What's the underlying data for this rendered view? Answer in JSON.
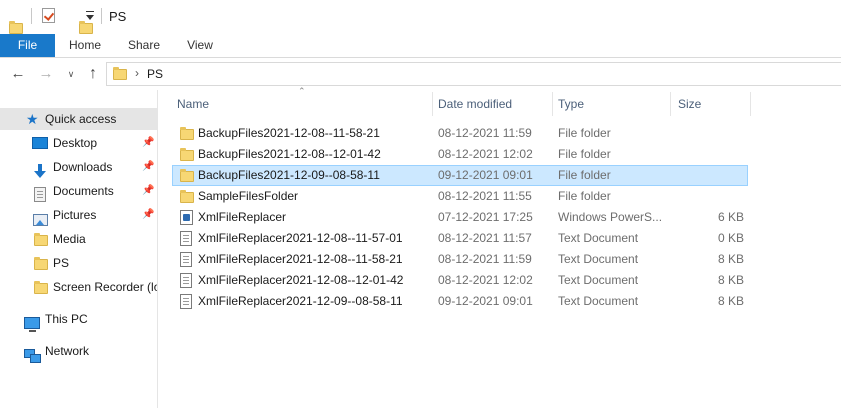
{
  "window": {
    "title": "PS"
  },
  "ribbon": {
    "tabs": [
      {
        "label": "File"
      },
      {
        "label": "Home"
      },
      {
        "label": "Share"
      },
      {
        "label": "View"
      }
    ]
  },
  "address": {
    "crumb": "PS"
  },
  "nav_pane": {
    "quick_access": {
      "label": "Quick access",
      "icon": "star-icon"
    },
    "items": [
      {
        "label": "Desktop",
        "icon": "desktop-icon",
        "pinned": true
      },
      {
        "label": "Downloads",
        "icon": "download-icon",
        "pinned": true
      },
      {
        "label": "Documents",
        "icon": "documents-icon",
        "pinned": true
      },
      {
        "label": "Pictures",
        "icon": "pictures-icon",
        "pinned": true
      },
      {
        "label": "Media",
        "icon": "folder-icon",
        "pinned": false
      },
      {
        "label": "PS",
        "icon": "folder-icon",
        "pinned": false
      },
      {
        "label": "Screen Recorder (lo",
        "icon": "folder-icon",
        "pinned": false
      }
    ],
    "this_pc": {
      "label": "This PC",
      "icon": "computer-icon"
    },
    "network": {
      "label": "Network",
      "icon": "network-icon"
    }
  },
  "columns": {
    "name": "Name",
    "date": "Date modified",
    "type": "Type",
    "size": "Size"
  },
  "files": [
    {
      "name": "BackupFiles2021-12-08--11-58-21",
      "date": "08-12-2021 11:59",
      "type": "File folder",
      "size": "",
      "icon": "folder-icon",
      "selected": false
    },
    {
      "name": "BackupFiles2021-12-08--12-01-42",
      "date": "08-12-2021 12:02",
      "type": "File folder",
      "size": "",
      "icon": "folder-icon",
      "selected": false
    },
    {
      "name": "BackupFiles2021-12-09--08-58-11",
      "date": "09-12-2021 09:01",
      "type": "File folder",
      "size": "",
      "icon": "folder-icon",
      "selected": true
    },
    {
      "name": "SampleFilesFolder",
      "date": "08-12-2021 11:55",
      "type": "File folder",
      "size": "",
      "icon": "folder-icon",
      "selected": false
    },
    {
      "name": "XmlFileReplacer",
      "date": "07-12-2021 17:25",
      "type": "Windows PowerS...",
      "size": "6 KB",
      "icon": "powershell-script-icon",
      "selected": false
    },
    {
      "name": "XmlFileReplacer2021-12-08--11-57-01",
      "date": "08-12-2021 11:57",
      "type": "Text Document",
      "size": "0 KB",
      "icon": "text-file-icon",
      "selected": false
    },
    {
      "name": "XmlFileReplacer2021-12-08--11-58-21",
      "date": "08-12-2021 11:59",
      "type": "Text Document",
      "size": "8 KB",
      "icon": "text-file-icon",
      "selected": false
    },
    {
      "name": "XmlFileReplacer2021-12-08--12-01-42",
      "date": "08-12-2021 12:02",
      "type": "Text Document",
      "size": "8 KB",
      "icon": "text-file-icon",
      "selected": false
    },
    {
      "name": "XmlFileReplacer2021-12-09--08-58-11",
      "date": "09-12-2021 09:01",
      "type": "Text Document",
      "size": "8 KB",
      "icon": "text-file-icon",
      "selected": false
    }
  ]
}
